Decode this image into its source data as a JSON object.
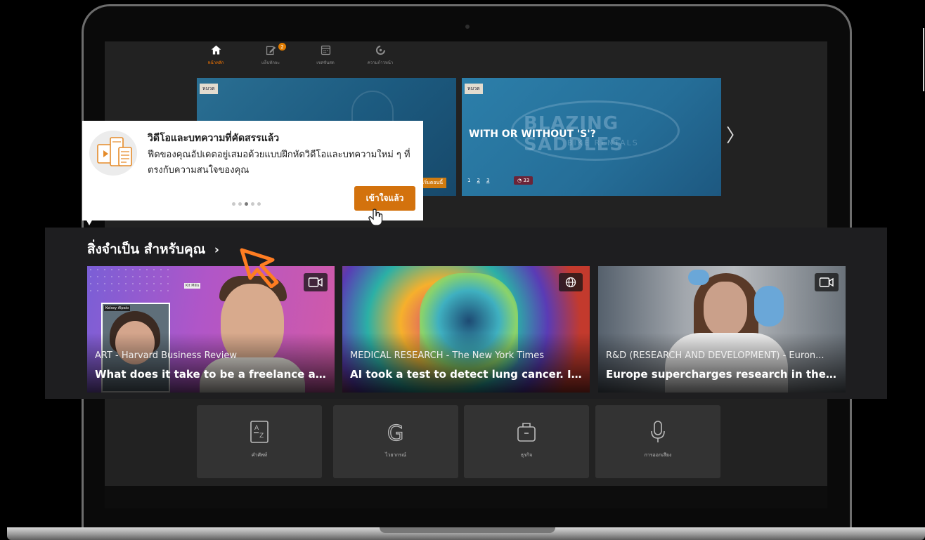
{
  "nav": {
    "items": [
      {
        "label": "หน้าหลัก",
        "icon": "home-icon",
        "active": true
      },
      {
        "label": "แล็บทักษะ",
        "icon": "edit-note-icon",
        "badge": "2"
      },
      {
        "label": "เซสชันสด",
        "icon": "calendar-icon"
      },
      {
        "label": "ความก้าวหน้า",
        "icon": "progress-ring-icon"
      }
    ]
  },
  "hero": {
    "cards": [
      {
        "tag": "หมวด",
        "button_label": "เริ่มตอนนี้"
      },
      {
        "tag": "หมวด",
        "title": "WITH OR WITHOUT 'S'?",
        "logo_text": "BLAZING SADDLES",
        "logo_sub": "BIKE RENTALS",
        "pages": [
          "1",
          "2",
          "3"
        ],
        "count": "33"
      }
    ],
    "next_icon": "chevron-right-icon"
  },
  "tooltip": {
    "title": "วิดีโอและบทความที่คัดสรรแล้ว",
    "body": "ฟีดของคุณอัปเดตอยู่เสมอด้วยแบบฝึกหัดวิดีโอและบทความใหม่ ๆ ที่ตรงกับความสนใจของคุณ",
    "button_label": "เข้าใจแล้ว",
    "dots_total": 5,
    "dots_active": 3
  },
  "section": {
    "title": "สิ่งจำเป็น สำหรับคุณ",
    "chevron": "›",
    "cards": [
      {
        "category": "ART - Harvard Business Review",
        "title": "What does it take to be a freelance artist?",
        "icon": "video-icon",
        "pip_name": "Kelsey Alpaio",
        "corner_label": "Kit Mills"
      },
      {
        "category": "MEDICAL RESEARCH - The New York Times",
        "title": "AI took a test to detect lung cancer. It got...",
        "icon": "globe-icon"
      },
      {
        "category": "R&D (RESEARCH AND DEVELOPMENT) - Euron...",
        "title": "Europe supercharges research in the batt...",
        "icon": "video-icon"
      }
    ]
  },
  "tiles": [
    {
      "label": "คำศัพท์",
      "icon": "dictionary-icon"
    },
    {
      "label": "ไวยากรณ์",
      "icon": "grammar-g-icon"
    },
    {
      "label": "ธุรกิจ",
      "icon": "briefcase-icon"
    },
    {
      "label": "การออกเสียง",
      "icon": "microphone-icon"
    }
  ],
  "colors": {
    "accent": "#d3720d",
    "nav_active": "#ff7a00",
    "badge": "#e07b00"
  }
}
